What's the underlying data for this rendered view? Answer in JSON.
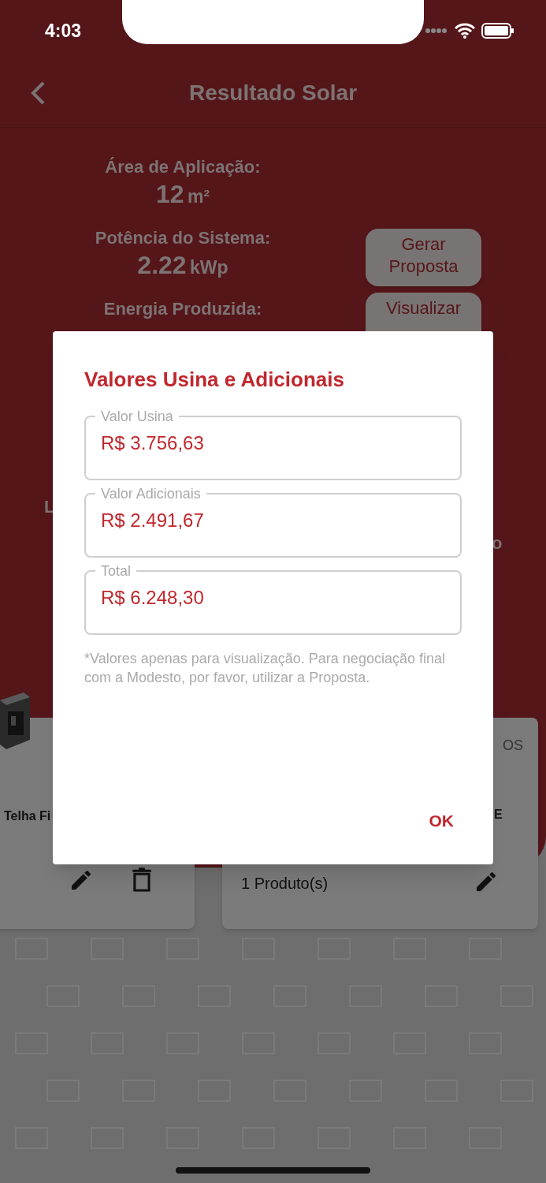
{
  "status_bar": {
    "time": "4:03"
  },
  "header": {
    "title": "Resultado Solar"
  },
  "summary": [
    {
      "label": "Área de Aplicação:",
      "value": "12",
      "unit": "m²"
    },
    {
      "label": "Potência do Sistema:",
      "value": "2.22",
      "unit": "kWp"
    },
    {
      "label": "Energia Produzida:"
    }
  ],
  "actions": [
    "Gerar Proposta",
    "Visualizar"
  ],
  "background_fragments": [
    "L",
    "o"
  ],
  "cards": [
    {
      "kind": "product",
      "title": "Telha Fi"
    },
    {
      "kind": "group",
      "caption": "OS",
      "title": "E",
      "count": "1 Produto(s)"
    }
  ],
  "dialog": {
    "title": "Valores Usina e Adicionais",
    "fields": [
      {
        "label": "Valor Usina",
        "value": "R$ 3.756,63"
      },
      {
        "label": "Valor Adicionais",
        "value": "R$ 2.491,67"
      },
      {
        "label": "Total",
        "value": "R$ 6.248,30"
      }
    ],
    "note": "*Valores apenas para visualização. Para negociação final com a Modesto, por favor, utilizar a Proposta.",
    "button": "OK"
  }
}
